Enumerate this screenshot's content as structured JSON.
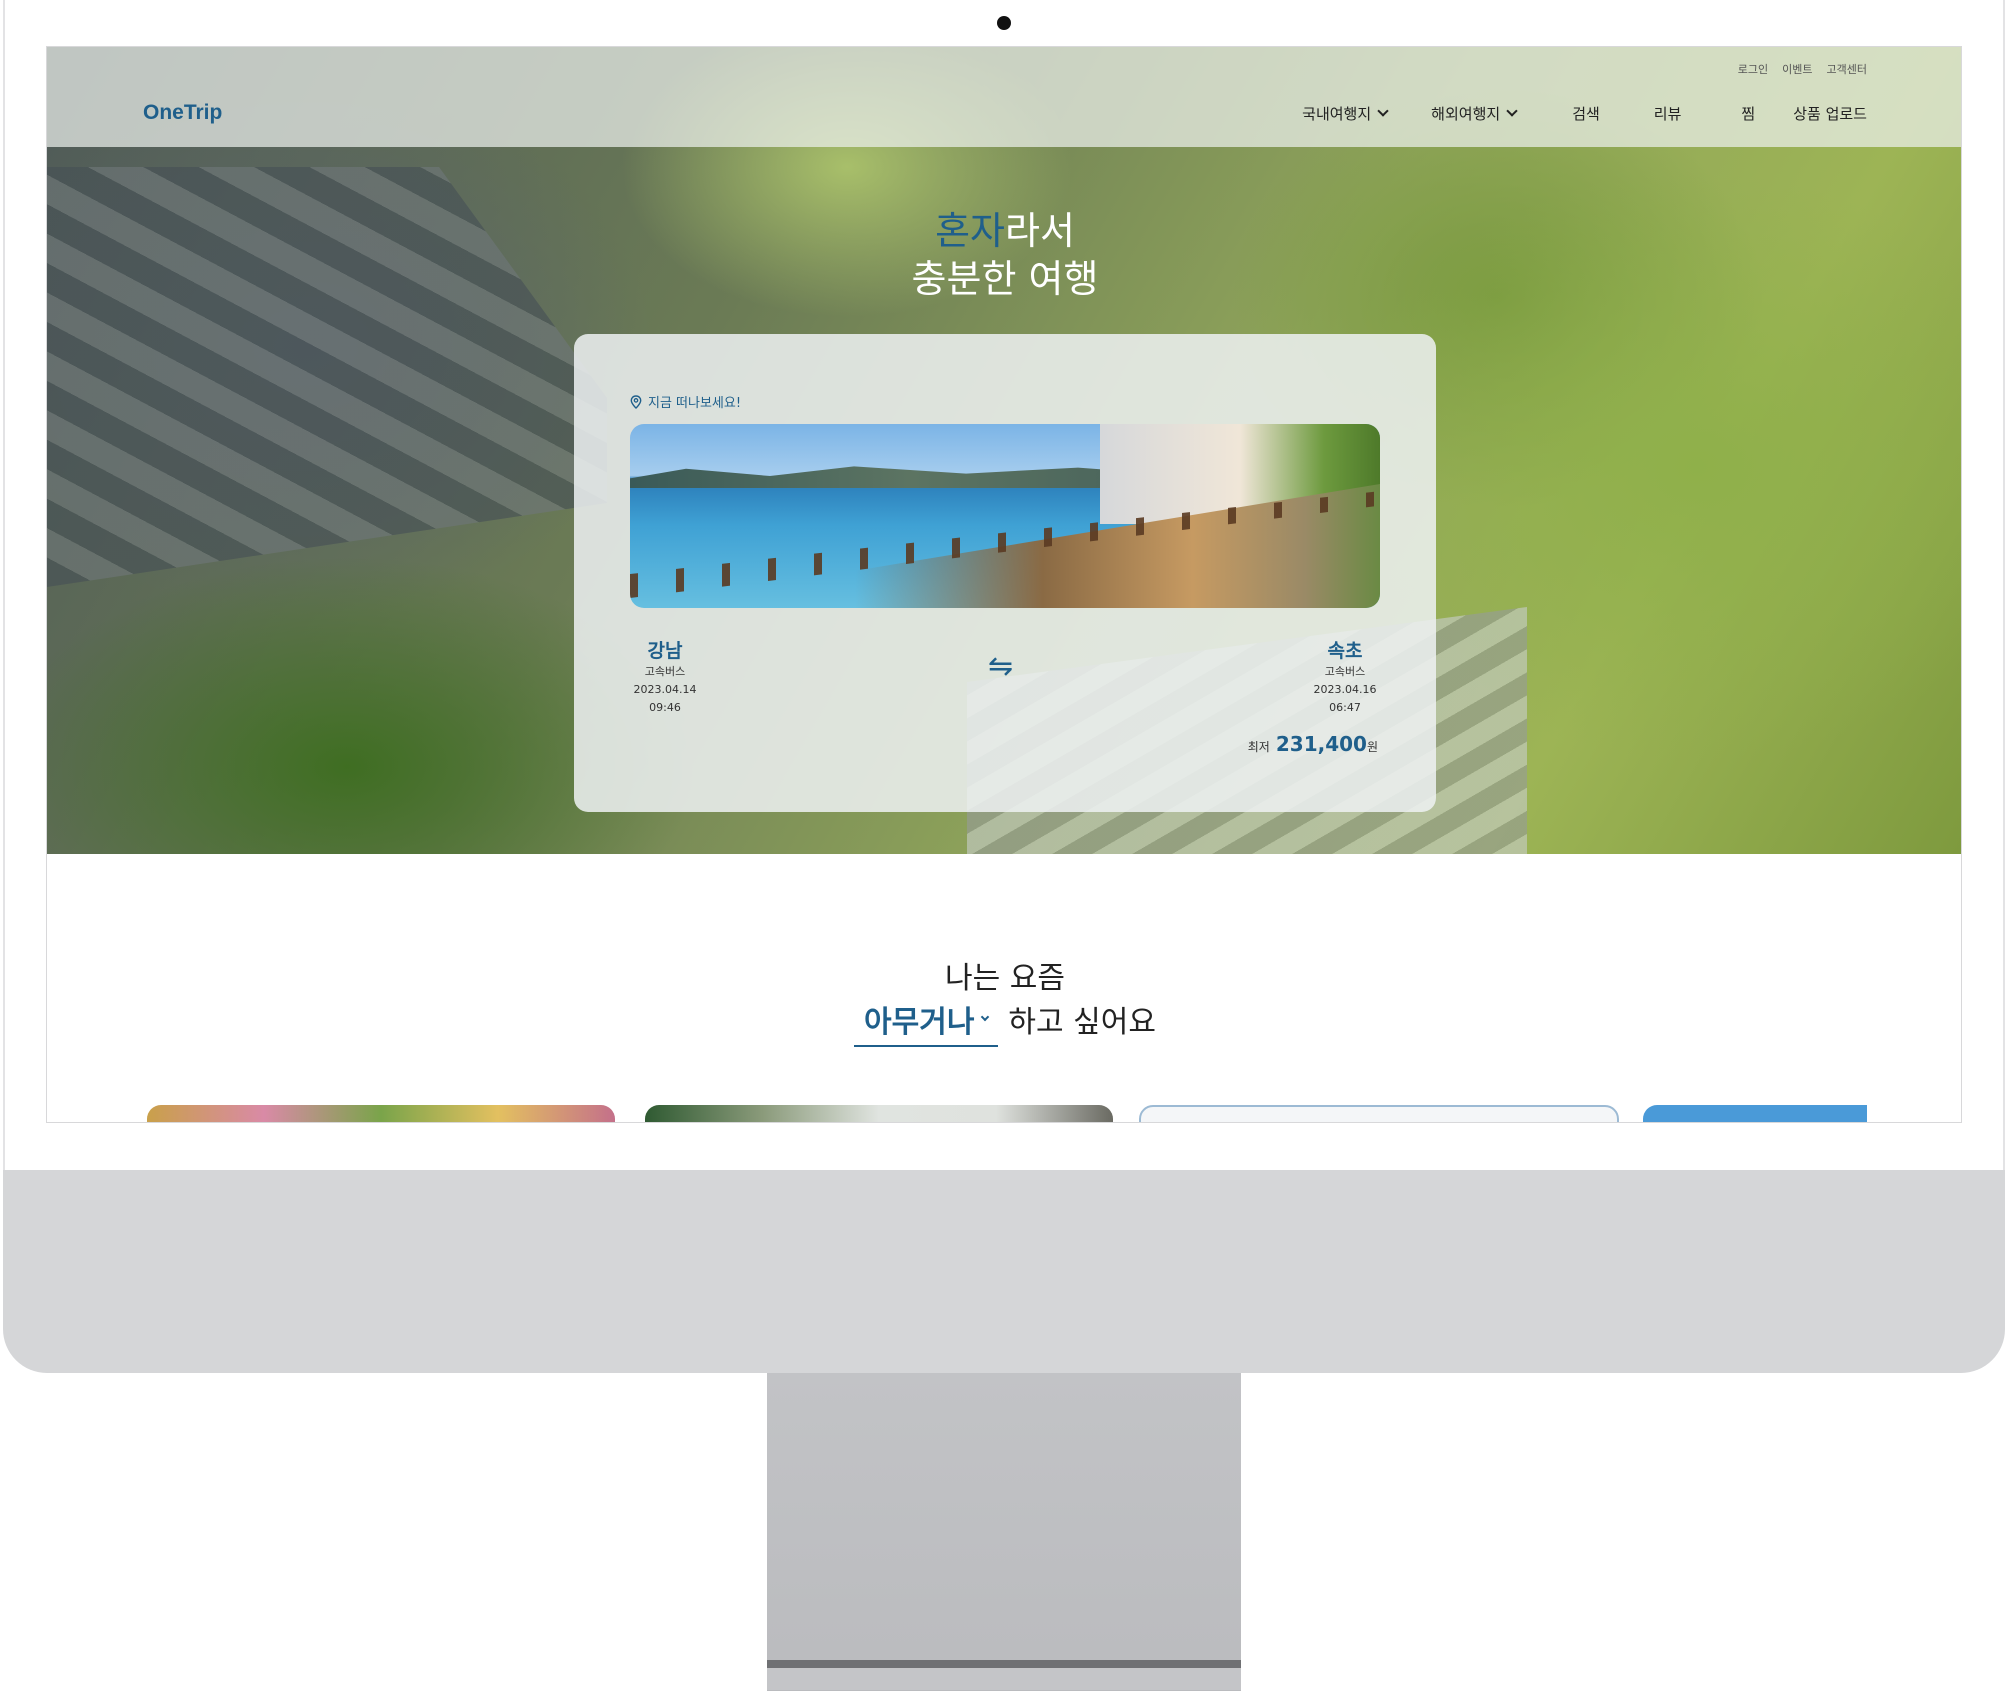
{
  "header": {
    "logo": "OneTrip",
    "util_links": [
      "로그인",
      "이벤트",
      "고객센터"
    ],
    "nav": [
      {
        "label": "국내여행지",
        "dropdown": true
      },
      {
        "label": "해외여행지",
        "dropdown": true
      },
      {
        "label": "검색",
        "dropdown": false
      },
      {
        "label": "리뷰",
        "dropdown": false
      },
      {
        "label": "찜",
        "dropdown": false
      },
      {
        "label": "상품 업로드",
        "dropdown": false
      }
    ]
  },
  "hero": {
    "title_accent": "혼자",
    "title_rest": "라서",
    "title_line2": "충분한 여행"
  },
  "card": {
    "tag": "지금 떠나보세요!",
    "origin": {
      "city": "강남",
      "transport": "고속버스",
      "date": "2023.04.14",
      "time": "09:46"
    },
    "destination": {
      "city": "속초",
      "transport": "고속버스",
      "date": "2023.04.16",
      "time": "06:47"
    },
    "swap_symbol": "⇋",
    "price_prefix": "최저",
    "price": "231,400",
    "price_unit": "원"
  },
  "section": {
    "line1": "나는 요즘",
    "select_value": "아무거나",
    "line2_suffix": "하고 싶어요"
  },
  "colors": {
    "brand": "#1f5f8b",
    "header_bg": "#ecf0ec",
    "device_chin": "#d5d6d8"
  }
}
